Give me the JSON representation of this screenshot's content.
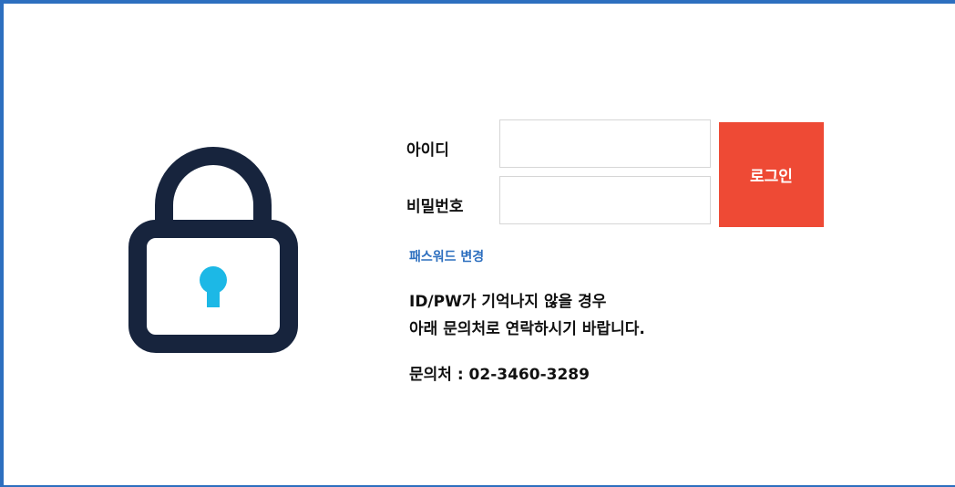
{
  "colors": {
    "frame_border": "#2d6fbf",
    "lock_body": "#17243d",
    "keyhole": "#1cb8e6",
    "login_button": "#ee4a35",
    "link": "#2d6fbf"
  },
  "lock": {
    "icon": "padlock-icon"
  },
  "login_form": {
    "id_label": "아이디",
    "id_value": "",
    "pw_label": "비밀번호",
    "pw_value": "",
    "login_button_label": "로그인"
  },
  "links": {
    "change_password": "패스워드 변경"
  },
  "notice": {
    "line1": "ID/PW가 기억나지 않을 경우",
    "line2": "아래 문의처로 연락하시기 바랍니다.",
    "contact": "문의처 : 02-3460-3289"
  }
}
